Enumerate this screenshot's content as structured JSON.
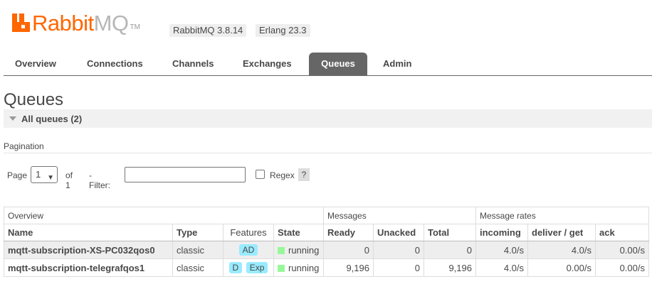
{
  "header": {
    "logo_text_1": "Rabbit",
    "logo_text_2": "MQ",
    "logo_tm": "TM",
    "rabbitmq_version": "RabbitMQ 3.8.14",
    "erlang_version": "Erlang 23.3"
  },
  "tabs": [
    {
      "label": "Overview"
    },
    {
      "label": "Connections"
    },
    {
      "label": "Channels"
    },
    {
      "label": "Exchanges"
    },
    {
      "label": "Queues"
    },
    {
      "label": "Admin"
    }
  ],
  "active_tab": "Queues",
  "page": {
    "title": "Queues",
    "section_label": "All queues (2)",
    "pagination_label": "Pagination"
  },
  "filter": {
    "page_label": "Page",
    "page_value": "1",
    "of_label": "of 1",
    "filter_label": "- Filter:",
    "filter_value": "",
    "regex_label": "Regex",
    "regex_checked": false,
    "help_label": "?"
  },
  "table": {
    "groups": [
      "Overview",
      "Messages",
      "Message rates"
    ],
    "columns": [
      "Name",
      "Type",
      "Features",
      "State",
      "Ready",
      "Unacked",
      "Total",
      "incoming",
      "deliver / get",
      "ack"
    ],
    "rows": [
      {
        "name": "mqtt-subscription-XS-PC032qos0",
        "type": "classic",
        "features": [
          "AD"
        ],
        "state": "running",
        "ready": "0",
        "unacked": "0",
        "total": "0",
        "incoming": "4.0/s",
        "deliver_get": "4.0/s",
        "ack": "0.00/s"
      },
      {
        "name": "mqtt-subscription-telegrafqos1",
        "type": "classic",
        "features": [
          "D",
          "Exp"
        ],
        "state": "running",
        "ready": "9,196",
        "unacked": "0",
        "total": "9,196",
        "incoming": "4.0/s",
        "deliver_get": "0.00/s",
        "ack": "0.00/s"
      }
    ]
  },
  "colors": {
    "brand": "#ff6600",
    "tab_active_bg": "#666666",
    "feature_badge": "#99ebff",
    "state_running": "#98f898"
  }
}
